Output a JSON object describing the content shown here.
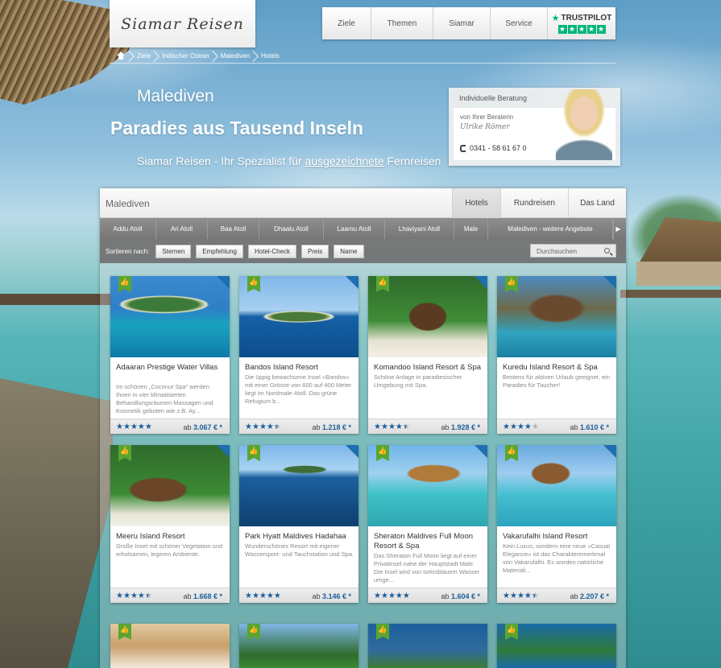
{
  "header": {
    "logo": "Siamar Reisen",
    "nav": [
      "Ziele",
      "Themen",
      "Siamar",
      "Service"
    ],
    "trustpilot": "TRUSTPILOT"
  },
  "breadcrumb": [
    "Ziele",
    "Indischer Ozean",
    "Malediven",
    "Hotels"
  ],
  "hero": {
    "title": "Malediven",
    "subtitle": "Paradies aus Tausend Inseln",
    "tagline_pre": "Siamar Reisen - Ihr Spezialist für ",
    "tagline_link": "ausgezeichnete",
    "tagline_post": " Fernreisen"
  },
  "advice": {
    "heading": "Individuelle Beratung",
    "by": "von Ihrer Beraterin",
    "name": "Ulrike Römer",
    "phone": "0341 - 58 61 67 0"
  },
  "panel": {
    "title": "Malediven",
    "tabs": [
      "Hotels",
      "Rundreisen",
      "Das Land"
    ],
    "regions": [
      "Addu Atoll",
      "Ari Atoll",
      "Baa Atoll",
      "Dhaalu Atoll",
      "Laamu Atoll",
      "Lhaviyani Atoll",
      "Male",
      "Malediven - weitere Angebote"
    ],
    "sort_label": "Sortieren nach:",
    "sort_options": [
      "Sternen",
      "Empfehlung",
      "Hotel-Check",
      "Preis",
      "Name"
    ],
    "search_placeholder": "Durchsuchen"
  },
  "colors": {
    "accent_blue": "#1d5f9c",
    "badge_green": "#5aa532"
  },
  "hotels": [
    {
      "name": "Adaaran Prestige Water Villas",
      "desc": "Im schönen „Coconut Spa“ werden Ihnen in vier klimatisierten Behandlungsräumen Massagen und Kosmetik geboten wie z.B. Ay...",
      "rating": 5,
      "price": "3.067 €",
      "price_prefix": "ab"
    },
    {
      "name": "Bandos Island Resort",
      "desc": "Die üppig bewachsene Insel »Bandos« mit einer Grösse von 600 auf 400 Meter liegt im Nordmale-Atoll. Das grüne Refugium b...",
      "rating": 4.5,
      "price": "1.218 €",
      "price_prefix": "ab"
    },
    {
      "name": "Komandoo Island Resort & Spa",
      "desc": "Schöne Anlage in paradiesischer Umgebung mit Spa.",
      "rating": 4.5,
      "price": "1.928 €",
      "price_prefix": "ab"
    },
    {
      "name": "Kuredu Island Resort & Spa",
      "desc": "Bestens für aktiven Urlaub geeignet, ein Paradies für Taucher!",
      "rating": 4,
      "price": "1.610 €",
      "price_prefix": "ab"
    },
    {
      "name": "Meeru Island Resort",
      "desc": "Große Insel mit schöner Vegetation und erholsamen, legeren Ambiente.",
      "rating": 4.5,
      "price": "1.668 €",
      "price_prefix": "ab"
    },
    {
      "name": "Park Hyatt Maldives Hadahaa",
      "desc": "Wunderschönes Resort mit eigener Wassersport- und Tauchstation und Spa.",
      "rating": 5,
      "price": "3.146 €",
      "price_prefix": "ab"
    },
    {
      "name": "Sheraton Maldives Full Moon Resort & Spa",
      "desc": "Das Sheraton Full Moon liegt auf einer Privatinsel nahe der Hauptstadt Male. Die Insel wird von türkisblauem Wasser umge...",
      "rating": 5,
      "price": "1.604 €",
      "price_prefix": "ab"
    },
    {
      "name": "Vakarufalhi Island Resort",
      "desc": "Kein Luxus, sondern eine neue »Casual Elegance« ist das Charakteremerkmal von Vakarufalhi. Es wurden natürliche Materiali...",
      "rating": 4.5,
      "price": "2.207 €",
      "price_prefix": "ab"
    }
  ],
  "price_suffix": "*"
}
